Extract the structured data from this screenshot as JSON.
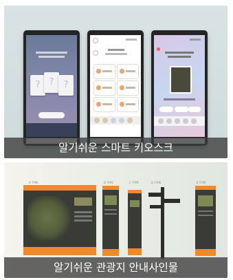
{
  "sections": [
    {
      "caption": "알기쉬운 스마트 키오스크"
    },
    {
      "caption": "알기쉬운 관광지 안내사인물"
    }
  ],
  "kiosk_screens": {
    "quiz_marks": [
      "?",
      "?",
      "?"
    ]
  },
  "sign_labels": {
    "types": [
      "A TYPE",
      "B TYPE",
      "C TYPE",
      "D TYPE",
      "E TYPE"
    ]
  },
  "colors": {
    "caption_bg": "#3c3c3c",
    "accent_orange": "#ee8a2a",
    "board_dark": "#3a3b36",
    "kiosk_card_bg": "#d9e3e4"
  }
}
